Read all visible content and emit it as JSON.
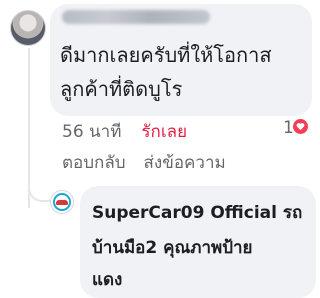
{
  "comment": {
    "author": "",
    "lines": [
      "ดีมากเลยครับที่ให้โอกาส",
      "ลูกค้าที่ติดบูโร"
    ],
    "time": "56 นาที",
    "like_label": "รักเลย",
    "reply_label": "ตอบกลับ",
    "message_label": "ส่งข้อความ",
    "reaction_count": "1",
    "reaction_icon": "heart-icon"
  },
  "reply": {
    "lines": [
      "SuperCar09 Official รถ",
      "บ้านมือ2 คุณภาพป้าย",
      "แดง"
    ]
  },
  "colors": {
    "bubble": "#f0f2f5",
    "meta_text": "#65676b",
    "love": "#e41e3f",
    "reaction": "#f33e58"
  }
}
